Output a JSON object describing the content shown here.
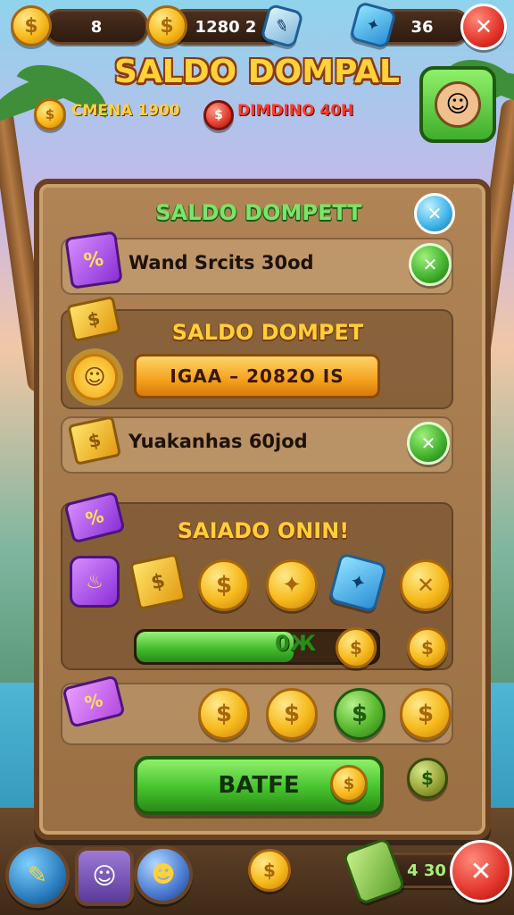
{
  "top_bar": {
    "coins_value": "8",
    "gold_value": "1280 2",
    "gems_value": "36",
    "coin_symbol": "$",
    "close_symbol": "✕",
    "gem_symbol": "✦",
    "ticket_symbol": "✎"
  },
  "header": {
    "title": "SALDO DOMPAL",
    "balance_left": "CMENA 1900",
    "balance_right": "DIMDINO 40H",
    "avatar_symbol": "☺"
  },
  "panel": {
    "title": "SALDO DOMPETT",
    "close_symbol": "✕",
    "row1": {
      "text": "Wand Srcits 30od",
      "icon_symbol": "%",
      "check_symbol": "✕"
    },
    "section2": {
      "title": "SALDO DOMPET",
      "bar_text": "IGAA – 2082O IS",
      "sun_symbol": "☺",
      "coin_symbol": "$"
    },
    "row3": {
      "text": "Yuakanhas 60jod",
      "icon_symbol": "$",
      "check_symbol": "✕"
    },
    "section4": {
      "title": "SAIADO ONIN!",
      "tag_symbol": "%",
      "items": [
        "♨",
        "$",
        "$",
        "✦",
        "✕"
      ],
      "progress_label": "0Ж",
      "progress_fraction": 0.65,
      "coin_symbol": "$"
    },
    "row5": {
      "items": [
        "$",
        "$",
        "$",
        "$"
      ],
      "tag_symbol": "%"
    },
    "action_button": {
      "label": "BATFE",
      "coin_symbol": "$",
      "side_coin_symbol": "$"
    }
  },
  "bottom_bar": {
    "left_icon": "✎",
    "avatar_symbol": "☺",
    "smile_symbol": "☻",
    "coin_symbol": "$",
    "value": "4 30",
    "close_symbol": "✕"
  }
}
